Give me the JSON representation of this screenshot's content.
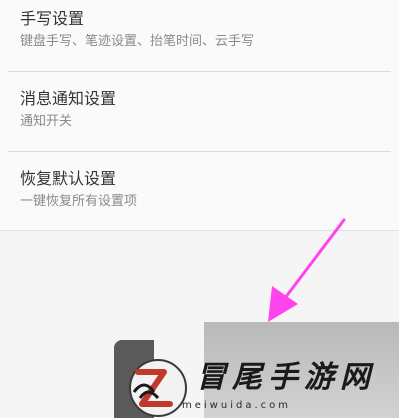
{
  "settings": {
    "items": [
      {
        "title": "手写设置",
        "subtitle": "键盘手写、笔迹设置、抬笔时间、云手写"
      },
      {
        "title": "消息通知设置",
        "subtitle": "通知开关"
      },
      {
        "title": "恢复默认设置",
        "subtitle": "一键恢复所有设置项"
      }
    ]
  },
  "annotation": {
    "arrow_color": "#ff44ee"
  },
  "watermark": {
    "brand": "冒尾手游网",
    "domain": "meiwuida.com"
  }
}
